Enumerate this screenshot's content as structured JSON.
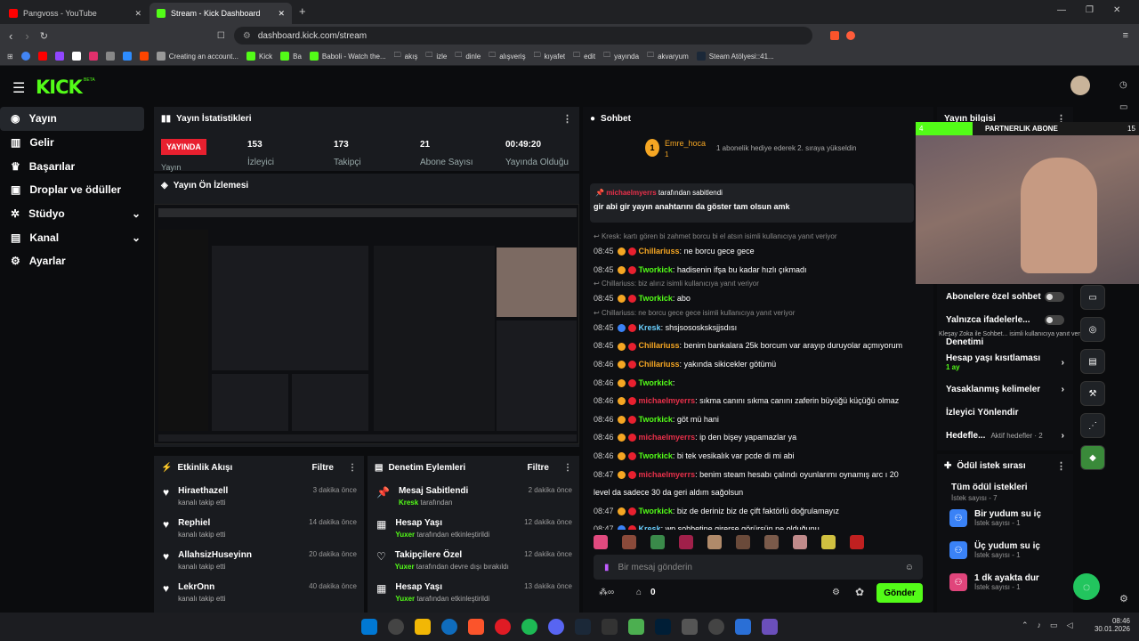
{
  "browser": {
    "tabs": [
      {
        "label": "Pangvoss - YouTube"
      },
      {
        "label": "Stream - Kick Dashboard"
      }
    ],
    "new_tab": "+",
    "url": "dashboard.kick.com/stream",
    "bookmarks": [
      "Creating an account...",
      "Kick",
      "Ba",
      "Baboli - Watch the...",
      "akış",
      "izle",
      "dinle",
      "alışveriş",
      "kıyafet",
      "edit",
      "yayında",
      "akvaryum",
      "Steam Atölyesi::41..."
    ],
    "window_controls": {
      "minimize": "—",
      "maximize": "❐",
      "close": "✕"
    }
  },
  "logo": "KICK",
  "logo_beta": "BETA",
  "sidebar": {
    "items": [
      {
        "label": "Yayın",
        "icon": "broadcast-icon"
      },
      {
        "label": "Gelir",
        "icon": "chart-icon"
      },
      {
        "label": "Başarılar",
        "icon": "trophy-icon"
      },
      {
        "label": "Droplar ve ödüller",
        "icon": "gift-icon"
      },
      {
        "label": "Stüdyo",
        "icon": "gear-icon"
      },
      {
        "label": "Kanal",
        "icon": "user-icon"
      },
      {
        "label": "Ayarlar",
        "icon": "settings-icon"
      }
    ]
  },
  "stats": {
    "title": "Yayın İstatistikleri",
    "live_badge": "YAYINDA",
    "live_sub": "Yayın",
    "items": [
      {
        "value": "153",
        "label": "İzleyici"
      },
      {
        "value": "173",
        "label": "Takipçi"
      },
      {
        "value": "21",
        "label": "Abone Sayısı"
      },
      {
        "value": "00:49:20",
        "label": "Yayında Olduğu"
      }
    ]
  },
  "preview": {
    "title": "Yayın Ön İzlemesi"
  },
  "activity": {
    "title": "Etkinlik Akışı",
    "filter": "Filtre",
    "items": [
      {
        "name": "Hiraethazell",
        "action": "kanalı takip etti",
        "time": "3 dakika önce"
      },
      {
        "name": "Rephiel",
        "action": "kanalı takip etti",
        "time": "14 dakika önce"
      },
      {
        "name": "AllahsizHuseyinn",
        "action": "kanalı takip etti",
        "time": "20 dakika önce"
      },
      {
        "name": "LekrOnn",
        "action": "kanalı takip etti",
        "time": "40 dakika önce"
      }
    ]
  },
  "moderation": {
    "title": "Denetim Eylemleri",
    "filter": "Filtre",
    "items": [
      {
        "name": "Mesaj Sabitlendi",
        "by": "Kresk",
        "action": " tarafından",
        "time": "2 dakika önce"
      },
      {
        "name": "Hesap Yaşı",
        "by": "Yuxer",
        "action": " tarafından etkinleştirildi",
        "time": "12 dakika önce"
      },
      {
        "name": "Takipçilere Özel",
        "by": "Yuxer",
        "action": " tarafından devre dışı bırakıldı",
        "time": "12 dakika önce"
      },
      {
        "name": "Hesap Yaşı",
        "by": "Yuxer",
        "action": " tarafından etkinleştirildi",
        "time": "13 dakika önce"
      }
    ]
  },
  "chat": {
    "title": "Sohbet",
    "top_user": "Emre_hoca",
    "top_count": "1",
    "top_note": "1 abonelik hediye ederek 2. sıraya yükseldin",
    "pinned_by": "michaelmyerrs",
    "pinned_by_suffix": " tarafından sabitlendi",
    "pinned_text": "gir abi gir yayın anahtarını da göster tam olsun amk",
    "messages": [
      {
        "reply": "Kresk: kartı gören bi zahmet borcu bi el atsın isimli kullanıcıya yanıt veriyor"
      },
      {
        "time": "08:45",
        "user": "Chillariuss",
        "cls": "u-o",
        "text": "ne borcu gece gece"
      },
      {
        "time": "08:45",
        "user": "Tworkick",
        "cls": "u-g",
        "text": "hadisenin ifşa bu kadar hızlı çıkmadı"
      },
      {
        "reply": "Chillariuss: biz alırız isimli kullanıcıya yanıt veriyor"
      },
      {
        "time": "08:45",
        "user": "Tworkick",
        "cls": "u-g",
        "text": "abo"
      },
      {
        "reply": "Chillariuss: ne borcu gece gece isimli kullanıcıya yanıt veriyor"
      },
      {
        "time": "08:45",
        "user": "Kresk",
        "cls": "u-b",
        "text": "shsjsososksksjjsdısı"
      },
      {
        "time": "08:45",
        "user": "Chillariuss",
        "cls": "u-o",
        "text": "benim bankalara 25k borcum var arayıp duruyolar açmıyorum"
      },
      {
        "time": "08:46",
        "user": "Chillariuss",
        "cls": "u-o",
        "text": "yakında sikicekler götümü"
      },
      {
        "time": "08:46",
        "user": "Tworkick",
        "cls": "u-g",
        "text": ""
      },
      {
        "time": "08:46",
        "user": "michaelmyerrs",
        "cls": "u-r",
        "text": "sıkma canını sıkma canını zaferin büyüğü küçüğü olmaz"
      },
      {
        "time": "08:46",
        "user": "Tworkick",
        "cls": "u-g",
        "text": "göt mü hani"
      },
      {
        "time": "08:46",
        "user": "michaelmyerrs",
        "cls": "u-r",
        "text": "ip den bişey yapamazlar ya"
      },
      {
        "time": "08:46",
        "user": "Tworkick",
        "cls": "u-g",
        "text": "bi tek vesikalık var pcde di mi abi"
      },
      {
        "time": "08:47",
        "user": "michaelmyerrs",
        "cls": "u-r",
        "text": "benim steam hesabı çalındı oyunlarımı oynamış arc ı 20"
      },
      {
        "cont": "level da sadece 30 da geri aldım sağolsun"
      },
      {
        "time": "08:47",
        "user": "Tworkick",
        "cls": "u-g",
        "text": "biz de deriniz biz de çift faktörlü doğrulamayız"
      },
      {
        "time": "08:47",
        "user": "Kresk",
        "cls": "u-b",
        "text": "wp sohbetine girerse görürsün ne olduğunu"
      }
    ],
    "input_placeholder": "Bir mesaj gönderin",
    "points": "0",
    "send": "Gönder"
  },
  "stream_info": {
    "title": "Yayın bilgisi",
    "sub_banner": "PARTNERLIK ABONE",
    "sub_left": "4",
    "sub_right": "15",
    "overlay_text": "Kleşay Zoka ile Sohbet...",
    "overlay_text2": "isimli kullanıcıya yanıt veriyor",
    "settings": [
      {
        "label": "Abonelere özel sohbet",
        "type": "toggle"
      },
      {
        "label": "Yalnızca ifadelerle...",
        "type": "toggle"
      },
      {
        "label": "Denetimi",
        "type": "none"
      },
      {
        "label": "Hesap yaşı kısıtlaması",
        "sub": "1 ay",
        "type": "chevron"
      },
      {
        "label": "Yasaklanmış kelimeler",
        "type": "chevron"
      },
      {
        "label": "İzleyici Yönlendir",
        "type": "none"
      },
      {
        "label": "Hedefle...",
        "sub": "Aktif hedefler · 2",
        "type": "chevron"
      }
    ]
  },
  "rewards": {
    "title": "Ödül istek sırası",
    "all": "Tüm ödül istekleri",
    "all_count": "İstek sayısı - 7",
    "items": [
      {
        "label": "Bir yudum su iç",
        "count": "İstek sayısı - 1",
        "color": "#3a82f6"
      },
      {
        "label": "Üç yudum su iç",
        "count": "İstek sayısı - 1",
        "color": "#3a82f6"
      },
      {
        "label": "1 dk ayakta dur",
        "count": "İstek sayısı - 1",
        "color": "#e0457b"
      }
    ]
  },
  "taskbar": {
    "time": "08:46",
    "date": "30.01.2026"
  },
  "colors": {
    "accent": "#53fc18",
    "live": "#e8202f",
    "panel": "#191b1f"
  }
}
